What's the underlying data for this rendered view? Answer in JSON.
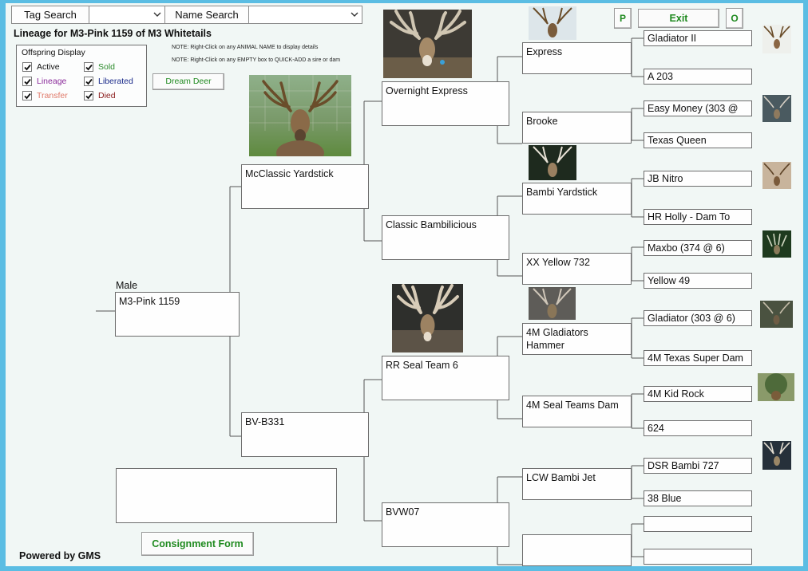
{
  "search": {
    "tag_label": "Tag Search",
    "name_label": "Name Search"
  },
  "header": {
    "title": "Lineage for M3-Pink 1159 of M3 Whitetails",
    "note1": "NOTE: Right-Click on any ANIMAL NAME to display details",
    "note2": "NOTE: Right-Click on any EMPTY box to QUICK-ADD a sire or dam"
  },
  "offspring": {
    "title": "Offspring Display",
    "items": [
      {
        "label": "Active",
        "color": "#111111",
        "checked": true
      },
      {
        "label": "Lineage",
        "color": "#8a2a9a",
        "checked": true
      },
      {
        "label": "Transfer",
        "color": "#e07a6a",
        "checked": true
      },
      {
        "label": "Sold",
        "color": "#2a8a2a",
        "checked": true
      },
      {
        "label": "Liberated",
        "color": "#1a2a8a",
        "checked": true
      },
      {
        "label": "Died",
        "color": "#8a1a1a",
        "checked": true
      }
    ]
  },
  "buttons": {
    "dream_deer": "Dream Deer",
    "p": "P",
    "exit": "Exit",
    "o": "O",
    "consignment": "Consignment Form"
  },
  "subject": {
    "sex": "Male",
    "name": "M3-Pink 1159"
  },
  "gen1": {
    "sire": "McClassic Yardstick",
    "dam": "BV-B331"
  },
  "gen2": {
    "a": "Overnight Express",
    "b": "Classic Bambilicious",
    "c": "RR Seal Team 6",
    "d": "BVW07"
  },
  "gen3": {
    "a": "Express",
    "b": "Brooke",
    "c": "Bambi Yardstick",
    "d": "XX Yellow 732",
    "e": "4M Gladiators Hammer",
    "f": "4M Seal Teams Dam",
    "g": "LCW Bambi Jet",
    "h": ""
  },
  "gen4": {
    "a": "Gladiator II",
    "b": "A 203",
    "c": "Easy Money (303 @",
    "d": "Texas Queen",
    "e": "JB Nitro",
    "f": "HR Holly - Dam To",
    "g": "Maxbo (374 @ 6)",
    "h": "Yellow 49",
    "i": "Gladiator (303 @ 6)",
    "j": "4M Texas Super Dam",
    "k": "4M Kid Rock",
    "l": "624",
    "m": "DSR Bambi 727",
    "n": "38 Blue",
    "o": "",
    "p": ""
  },
  "footer": {
    "powered": "Powered by GMS"
  },
  "colors": {
    "frame": "#5bbde3",
    "background": "#f1f7f5",
    "button_text": "#1f8a1f"
  }
}
